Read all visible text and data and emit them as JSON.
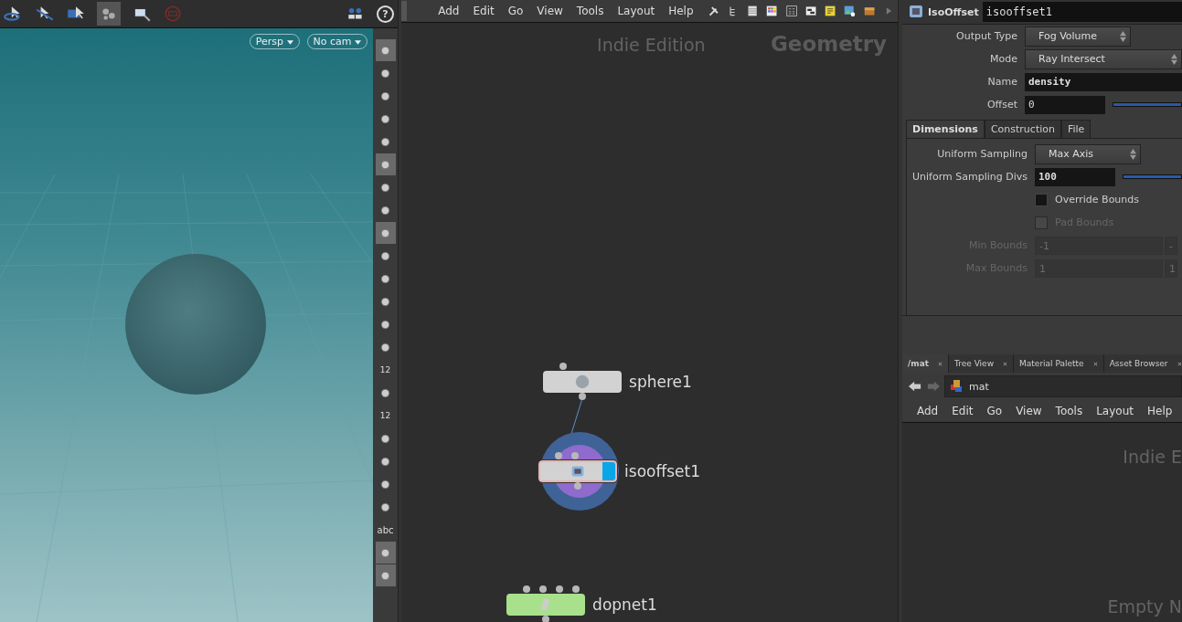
{
  "viewport": {
    "help": "?",
    "view_buttons": [
      {
        "label": "Persp"
      },
      {
        "label": "No cam"
      }
    ]
  },
  "viewport_tools": [
    {
      "kind": "icon",
      "selected": true
    },
    {
      "kind": "icon",
      "selected": false
    },
    {
      "kind": "icon",
      "selected": false
    },
    {
      "kind": "icon",
      "selected": false
    },
    {
      "kind": "icon",
      "selected": false
    },
    {
      "kind": "icon",
      "selected": true
    },
    {
      "kind": "icon",
      "selected": false
    },
    {
      "kind": "icon",
      "selected": false
    },
    {
      "kind": "icon",
      "selected": true
    },
    {
      "kind": "icon",
      "selected": false
    },
    {
      "kind": "icon",
      "selected": false
    },
    {
      "kind": "icon",
      "selected": false
    },
    {
      "kind": "icon",
      "selected": false
    },
    {
      "kind": "icon",
      "selected": false
    },
    {
      "kind": "numbered",
      "label": "12",
      "selected": false
    },
    {
      "kind": "icon",
      "selected": false
    },
    {
      "kind": "numbered",
      "label": "12",
      "selected": false
    },
    {
      "kind": "icon",
      "selected": false
    },
    {
      "kind": "icon",
      "selected": false
    },
    {
      "kind": "icon",
      "selected": false
    },
    {
      "kind": "icon",
      "selected": false
    },
    {
      "kind": "text",
      "label": "abc",
      "selected": false
    },
    {
      "kind": "icon",
      "selected": true
    },
    {
      "kind": "icon",
      "selected": true
    }
  ],
  "network": {
    "menu": [
      "Add",
      "Edit",
      "Go",
      "View",
      "Tools",
      "Layout",
      "Help"
    ],
    "watermark": "Indie Edition",
    "context": "Geometry",
    "nodes": [
      {
        "name": "sphere1",
        "kind": "sphere",
        "selected": false,
        "display": false,
        "color": "#d2d2d2"
      },
      {
        "name": "isooffset1",
        "kind": "isooffset",
        "selected": true,
        "display": true,
        "color": "#d2d2d2"
      },
      {
        "name": "dopnet1",
        "kind": "dopnet",
        "selected": false,
        "display": false,
        "color": "#a8e08c"
      }
    ]
  },
  "parameters": {
    "type_label": "IsoOffset",
    "node_name": "isooffset1",
    "params": [
      {
        "kind": "menu",
        "label": "Output Type",
        "value": "Fog Volume"
      },
      {
        "kind": "menu",
        "label": "Mode",
        "value": "Ray Intersect"
      },
      {
        "kind": "text",
        "label": "Name",
        "value": "density"
      },
      {
        "kind": "slider",
        "label": "Offset",
        "value": "0"
      }
    ],
    "tabs": [
      {
        "label": "Dimensions",
        "selected": true
      },
      {
        "label": "Construction",
        "selected": false
      },
      {
        "label": "File",
        "selected": false
      }
    ],
    "tab_params": [
      {
        "kind": "menu",
        "label": "Uniform Sampling",
        "value": "Max Axis"
      },
      {
        "kind": "slider",
        "label": "Uniform Sampling Divs",
        "value": "100"
      },
      {
        "kind": "checkbox",
        "label": "Override Bounds",
        "checked": false,
        "disabled": false
      },
      {
        "kind": "checkbox",
        "label": "Pad Bounds",
        "checked": false,
        "disabled": true
      },
      {
        "kind": "vector",
        "label": "Min Bounds",
        "values": [
          "-1",
          "-"
        ],
        "disabled": true
      },
      {
        "kind": "vector",
        "label": "Max Bounds",
        "values": [
          "1",
          "1"
        ],
        "disabled": true
      }
    ]
  },
  "lower_pane": {
    "tabs": [
      {
        "label": "/mat",
        "selected": true
      },
      {
        "label": "Tree View",
        "selected": false
      },
      {
        "label": "Material Palette",
        "selected": false
      },
      {
        "label": "Asset Browser",
        "selected": false
      }
    ],
    "path": "mat",
    "menu": [
      "Add",
      "Edit",
      "Go",
      "View",
      "Tools",
      "Layout",
      "Help"
    ],
    "watermark": "Indie E",
    "empty_note": "Empty N"
  }
}
